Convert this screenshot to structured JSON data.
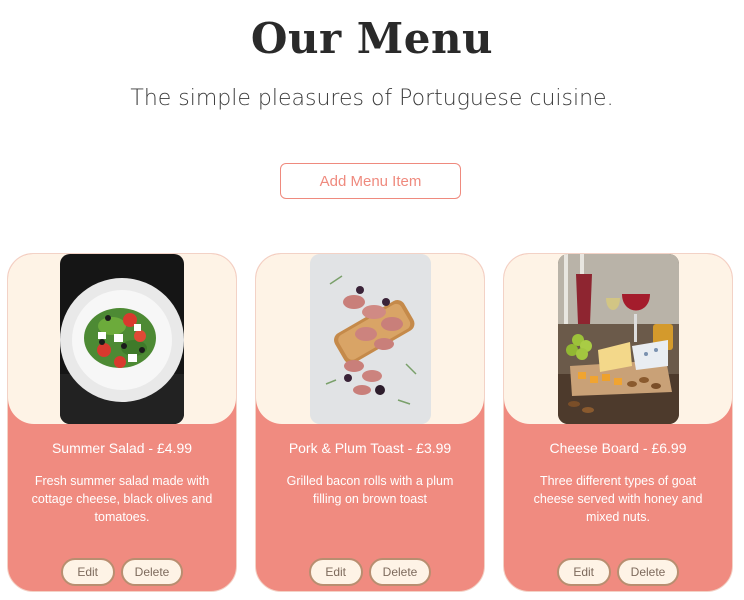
{
  "header": {
    "title": "Our Menu",
    "subtitle": "The simple pleasures of Portuguese cuisine.",
    "add_button_label": "Add Menu Item"
  },
  "colors": {
    "accent": "#f08b80",
    "card_top": "#fef3e6",
    "button_border": "#b88e70"
  },
  "menu": {
    "items": [
      {
        "title": "Summer Salad - £4.99",
        "description": "Fresh summer salad made with cottage cheese, black olives and tomatoes.",
        "image_icon": "salad-photo",
        "edit_label": "Edit",
        "delete_label": "Delete"
      },
      {
        "title": "Pork & Plum Toast - £3.99",
        "description": "Grilled bacon rolls with a plum filling on brown toast",
        "image_icon": "toast-photo",
        "edit_label": "Edit",
        "delete_label": "Delete"
      },
      {
        "title": "Cheese Board - £6.99",
        "description": "Three different types of goat cheese served with honey and mixed nuts.",
        "image_icon": "cheese-board-photo",
        "edit_label": "Edit",
        "delete_label": "Delete"
      }
    ]
  }
}
